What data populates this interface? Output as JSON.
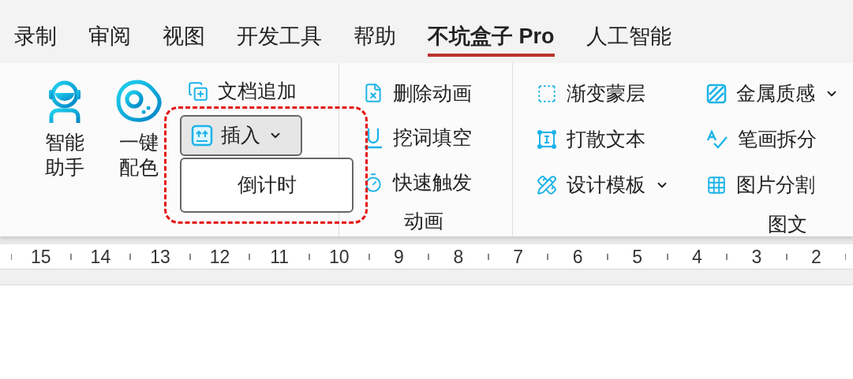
{
  "menu_tabs": [
    {
      "label": "录制",
      "selected": false
    },
    {
      "label": "审阅",
      "selected": false
    },
    {
      "label": "视图",
      "selected": false
    },
    {
      "label": "开发工具",
      "selected": false
    },
    {
      "label": "帮助",
      "selected": false
    },
    {
      "label": "不坑盒子 Pro",
      "selected": true
    },
    {
      "label": "人工智能",
      "selected": false
    }
  ],
  "large_buttons": [
    {
      "label": "智能助手"
    },
    {
      "label": "一键配色"
    }
  ],
  "doc_append": {
    "label": "文档追加"
  },
  "insert_button": {
    "label": "插入",
    "expanded": true
  },
  "insert_menu": [
    {
      "label": "倒计时"
    }
  ],
  "animation_group": {
    "title": "动画",
    "items": [
      {
        "label": "删除动画"
      },
      {
        "label": "挖词填空"
      },
      {
        "label": "快速触发"
      }
    ]
  },
  "text_group": {
    "title": "图文",
    "columns": [
      [
        {
          "label": "渐变蒙层",
          "has_menu": false
        },
        {
          "label": "打散文本",
          "has_menu": false
        },
        {
          "label": "设计模板",
          "has_menu": true
        }
      ],
      [
        {
          "label": "金属质感",
          "has_menu": true
        },
        {
          "label": "笔画拆分",
          "has_menu": false
        },
        {
          "label": "图片分割",
          "has_menu": false
        }
      ]
    ]
  },
  "ruler": {
    "numbers": [
      "15",
      "14",
      "13",
      "12",
      "11",
      "10",
      "9",
      "8",
      "7",
      "6",
      "5",
      "4",
      "3",
      "2"
    ]
  }
}
